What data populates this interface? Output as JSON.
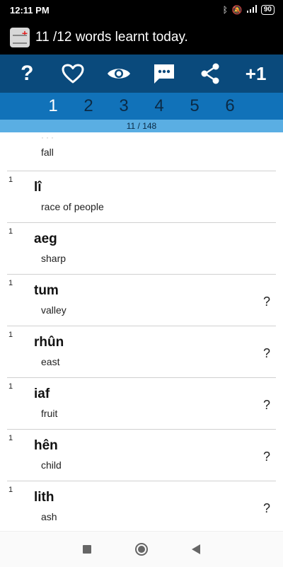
{
  "status": {
    "time": "12:11 PM",
    "battery": "90"
  },
  "title": {
    "text": "11 /12 words learnt today."
  },
  "toolbar": {
    "help_label": "?",
    "heart_icon": "heart-icon",
    "eye_icon": "eye-icon",
    "comment_icon": "comment-icon",
    "share_icon": "share-icon",
    "plus_label": "+1"
  },
  "tabs": [
    {
      "label": "1"
    },
    {
      "label": "2"
    },
    {
      "label": "3"
    },
    {
      "label": "4"
    },
    {
      "label": "5"
    },
    {
      "label": "6"
    }
  ],
  "progress": {
    "text": "11 / 148"
  },
  "words": [
    {
      "count": "",
      "word": "",
      "meaning": "fall",
      "help": ""
    },
    {
      "count": "1",
      "word": "lî",
      "meaning": "race of people",
      "help": ""
    },
    {
      "count": "1",
      "word": "aeg",
      "meaning": "sharp",
      "help": ""
    },
    {
      "count": "1",
      "word": "tum",
      "meaning": "valley",
      "help": "?"
    },
    {
      "count": "1",
      "word": "rhûn",
      "meaning": "east",
      "help": "?"
    },
    {
      "count": "1",
      "word": "iaf",
      "meaning": "fruit",
      "help": "?"
    },
    {
      "count": "1",
      "word": "hên",
      "meaning": "child",
      "help": "?"
    },
    {
      "count": "1",
      "word": "lith",
      "meaning": "ash",
      "help": "?"
    }
  ],
  "colors": {
    "toolbar": "#0a4a7c",
    "tabs": "#1172b9",
    "progress": "#5aaee3"
  }
}
